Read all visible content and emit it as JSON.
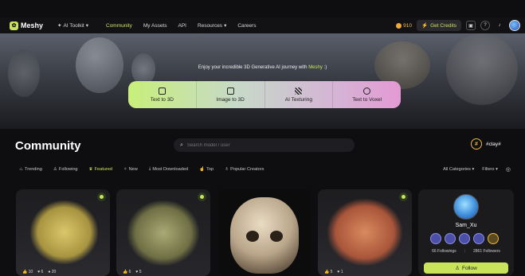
{
  "nav": {
    "logo": "Meshy",
    "items": [
      {
        "label": "AI Toolkit",
        "icon": "sparkle-icon",
        "dropdown": true,
        "active": false
      },
      {
        "label": "Community",
        "active": true
      },
      {
        "label": "My Assets",
        "active": false
      },
      {
        "label": "API",
        "active": false
      },
      {
        "label": "Resources",
        "dropdown": true,
        "active": false
      },
      {
        "label": "Careers",
        "active": false
      }
    ],
    "credits": "910",
    "get_credits": "Get Credits"
  },
  "hero": {
    "tagline_prefix": "Enjoy your incredible 3D Generative AI journey with ",
    "tagline_brand": "Meshy",
    "tagline_suffix": " :)",
    "features": [
      {
        "label": "Text to 3D",
        "icon": "cube-icon"
      },
      {
        "label": "Image to 3D",
        "icon": "image-icon"
      },
      {
        "label": "AI Texturing",
        "icon": "texture-icon"
      },
      {
        "label": "Text to Voxel",
        "icon": "voxel-icon"
      }
    ]
  },
  "community": {
    "title": "Community",
    "search_placeholder": "Search model / user",
    "hashtag": "#clay#"
  },
  "tabs": [
    {
      "label": "Trending",
      "icon": "flame-icon",
      "active": false
    },
    {
      "label": "Following",
      "icon": "user-icon",
      "active": false
    },
    {
      "label": "Featured",
      "icon": "crown-icon",
      "active": true
    },
    {
      "label": "New",
      "icon": "sparkle-icon",
      "active": false
    },
    {
      "label": "Most Downloaded",
      "icon": "download-icon",
      "active": false
    },
    {
      "label": "Top",
      "icon": "thumbs-up-icon",
      "active": false
    },
    {
      "label": "Popular Creators",
      "icon": "users-icon",
      "active": false
    }
  ],
  "filters": {
    "categories": "All Categories",
    "filters": "Filters"
  },
  "cards": [
    {
      "likes": "10",
      "hearts": "6",
      "extra": "20"
    },
    {
      "likes": "6",
      "hearts": "5",
      "extra": ""
    },
    {
      "likes": "",
      "hearts": "",
      "extra": ""
    },
    {
      "likes": "5",
      "hearts": "1",
      "extra": ""
    }
  ],
  "profile": {
    "name": "Sam_Xu",
    "followings": "66 Followings",
    "followers": "2861 Followers",
    "follow_label": "Follow"
  }
}
